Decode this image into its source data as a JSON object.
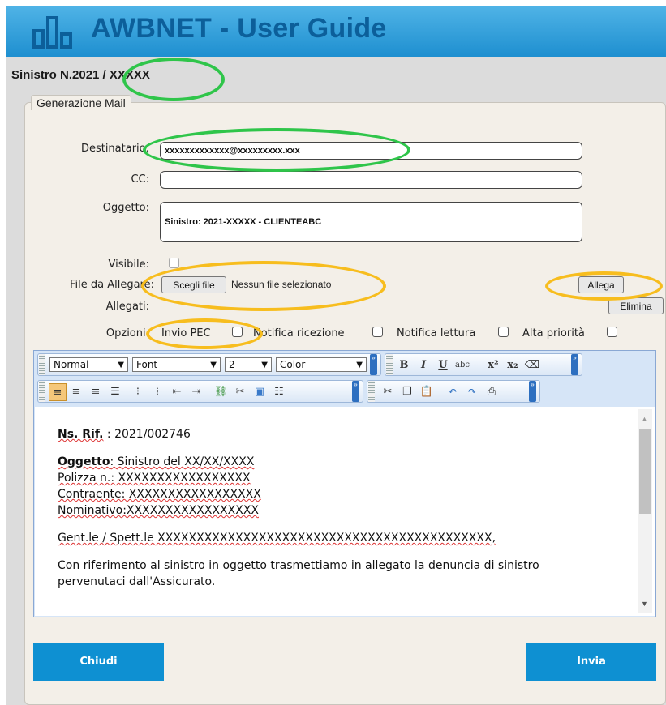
{
  "app": {
    "title": "AWBNET - User Guide"
  },
  "window": {
    "title": "Sinistro N.2021 / XXXXX"
  },
  "section": {
    "legend": "Generazione Mail"
  },
  "form": {
    "destinatario_label": "Destinatario:",
    "destinatario_value": "xxxxxxxxxxxxx@xxxxxxxxx.xxx",
    "cc_label": "CC:",
    "cc_value": "",
    "oggetto_label": "Oggetto:",
    "oggetto_value": "Sinistro: 2021-XXXXX - CLIENTEABC",
    "visibile_label": "Visibile:",
    "file_label": "File da Allegare:",
    "file_button": "Scegli file",
    "file_status": "Nessun file selezionato",
    "allega_button": "Allega",
    "allegati_label": "Allegati:",
    "elimina_button": "Elimina",
    "opzioni_label": "Opzioni:",
    "options": [
      {
        "label": "Invio PEC",
        "checked": false
      },
      {
        "label": "Notifica ricezione",
        "checked": false
      },
      {
        "label": "Notifica lettura",
        "checked": false
      },
      {
        "label": "Alta priorità",
        "checked": false
      }
    ]
  },
  "toolbar": {
    "format_select": "Normal",
    "font_select": "Font",
    "size_select": "2",
    "color_select": "Color",
    "bold": "B",
    "italic": "I",
    "underline": "U",
    "strike": "abc"
  },
  "body": {
    "rif_label": "Ns. Rif.",
    "rif_value": " : 2021/002746",
    "oggetto_label": "Oggetto",
    "oggetto_value": ": Sinistro del XX/XX/XXXX",
    "polizza": "Polizza n.: XXXXXXXXXXXXXXXXX",
    "contraente": "Contraente: XXXXXXXXXXXXXXXXX",
    "nominativo": "Nominativo:XXXXXXXXXXXXXXXXX",
    "saluto": "Gent.le / Spett.le XXXXXXXXXXXXXXXXXXXXXXXXXXXXXXXXXXXXXXXXXXX,",
    "paragrafo": "Con riferimento al sinistro in oggetto trasmettiamo in allegato la denuncia di sinistro pervenutaci dall'Assicurato."
  },
  "actions": {
    "close": "Chiudi",
    "send": "Invia"
  },
  "colors": {
    "banner": "#1e8fd0",
    "primary_button": "#0e90d2",
    "highlight_green": "#2fc54a",
    "highlight_yellow": "#f7bd1e"
  }
}
